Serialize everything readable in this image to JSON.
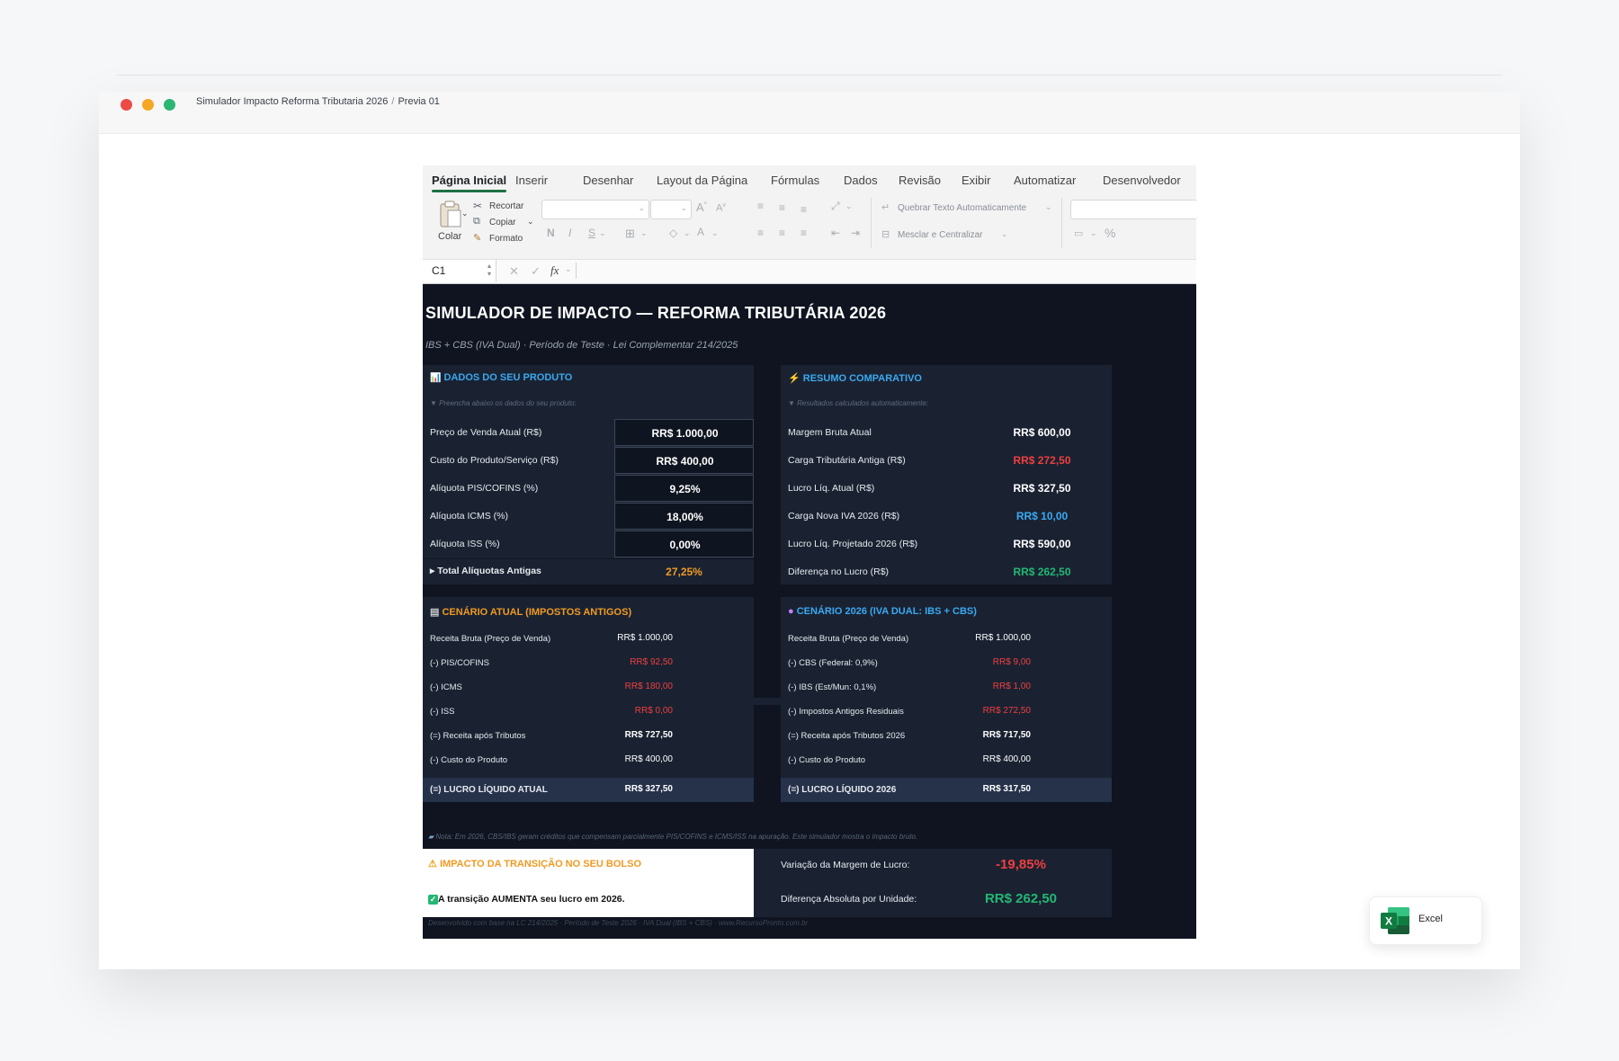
{
  "window": {
    "breadcrumb": [
      "Simulador Impacto Reforma Tributaria 2026",
      "Previa 01"
    ]
  },
  "ribbon": {
    "tabs": [
      "Página Inicial",
      "Inserir",
      "Desenhar",
      "Layout da Página",
      "Fórmulas",
      "Dados",
      "Revisão",
      "Exibir",
      "Automatizar",
      "Desenvolvedor"
    ],
    "paste_label": "Colar",
    "cut_label": "Recortar",
    "copy_label": "Copiar",
    "format_label": "Formato",
    "bold_glyph": "N",
    "italic_glyph": "I",
    "underline_glyph": "S",
    "wrap_label": "Quebrar Texto Automaticamente",
    "merge_label": "Mesclar e Centralizar",
    "percent_glyph": "%"
  },
  "formula_bar": {
    "name_box": "C1",
    "fx_label": "fx",
    "value": ""
  },
  "sheet": {
    "title": "SIMULADOR DE IMPACTO — REFORMA TRIBUTÁRIA 2026",
    "subtitle": "IBS + CBS (IVA Dual) · Período de Teste · Lei Complementar 214/2025",
    "inputs": {
      "title": "DADOS DO SEU PRODUTO",
      "hint": "▼ Preencha abaixo os dados do seu produto:",
      "rows": [
        {
          "label": "Preço de Venda Atual (R$)",
          "value": "RR$ 1.000,00"
        },
        {
          "label": "Custo do Produto/Serviço (R$)",
          "value": "RR$ 400,00"
        },
        {
          "label": "Alíquota PIS/COFINS (%)",
          "value": "9,25%"
        },
        {
          "label": "Alíquota ICMS (%)",
          "value": "18,00%"
        },
        {
          "label": "Alíquota ISS (%)",
          "value": "0,00%"
        }
      ],
      "total_label": "▸ Total Alíquotas Antigas",
      "total_value": "27,25%"
    },
    "summary": {
      "title": "RESUMO COMPARATIVO",
      "hint": "▼ Resultados calculados automaticamente:",
      "rows": [
        {
          "label": "Margem Bruta Atual",
          "value": "RR$ 600,00"
        },
        {
          "label": "Carga Tributária Antiga (R$)",
          "value": "RR$ 272,50"
        },
        {
          "label": "Lucro Líq. Atual (R$)",
          "value": "RR$ 327,50"
        },
        {
          "label": "Carga Nova IVA 2026 (R$)",
          "value": "RR$ 10,00"
        },
        {
          "label": "Lucro Líq. Projetado 2026 (R$)",
          "value": "RR$ 590,00"
        },
        {
          "label": "Diferença no Lucro (R$)",
          "value": "RR$ 262,50"
        }
      ]
    },
    "current": {
      "title": "CENÁRIO ATUAL (IMPOSTOS ANTIGOS)",
      "rows": [
        {
          "label": "Receita Bruta (Preço de Venda)",
          "value": "RR$ 1.000,00"
        },
        {
          "label": "(-) PIS/COFINS",
          "value": "RR$ 92,50"
        },
        {
          "label": "(-) ICMS",
          "value": "RR$ 180,00"
        },
        {
          "label": "(-) ISS",
          "value": "RR$ 0,00"
        },
        {
          "label": "(=) Receita após Tributos",
          "value": "RR$ 727,50"
        },
        {
          "label": "(-) Custo do Produto",
          "value": "RR$ 400,00"
        }
      ],
      "total_label": "(=) LUCRO LÍQUIDO ATUAL",
      "total_value": "RR$ 327,50"
    },
    "future": {
      "title": "CENÁRIO 2026 (IVA DUAL: IBS + CBS)",
      "rows": [
        {
          "label": "Receita Bruta (Preço de Venda)",
          "value": "RR$ 1.000,00"
        },
        {
          "label": "(-) CBS (Federal: 0,9%)",
          "value": "RR$ 9,00"
        },
        {
          "label": "(-) IBS (Est/Mun: 0,1%)",
          "value": "RR$ 1,00"
        },
        {
          "label": "(-) Impostos Antigos Residuais",
          "value": "RR$ 272,50"
        },
        {
          "label": "(=) Receita após Tributos 2026",
          "value": "RR$ 717,50"
        },
        {
          "label": "(-) Custo do Produto",
          "value": "RR$ 400,00"
        }
      ],
      "total_label": "(=) LUCRO LÍQUIDO 2026",
      "total_value": "RR$ 317,50"
    },
    "note": "Nota: Em 2026, CBS/IBS geram créditos que compensam parcialmente PIS/COFINS e ICMS/ISS na apuração. Este simulador mostra o impacto bruto.",
    "impact": {
      "title": "IMPACTO DA TRANSIÇÃO NO SEU BOLSO",
      "message": "A transição AUMENTA seu lucro em 2026.",
      "margin_label": "Variação da Margem de Lucro:",
      "margin_value": "-19,85%",
      "abs_label": "Diferença Absoluta por Unidade:",
      "abs_value": "RR$ 262,50"
    },
    "footer": "Desenvolvido com base na LC 214/2025 · Período de Teste 2026 · IVA Dual (IBS + CBS) · www.RecursoPronto.com.br"
  },
  "app_badge": {
    "name": "Excel",
    "accent": "#1e7145"
  },
  "colors": {
    "sheet_bg": "#0f1420",
    "panel_bg": "#1a2232",
    "accent_blue": "#3aa9f0",
    "accent_orange": "#f09a23",
    "negative_red": "#ef3f3f",
    "positive_green": "#22b872"
  }
}
